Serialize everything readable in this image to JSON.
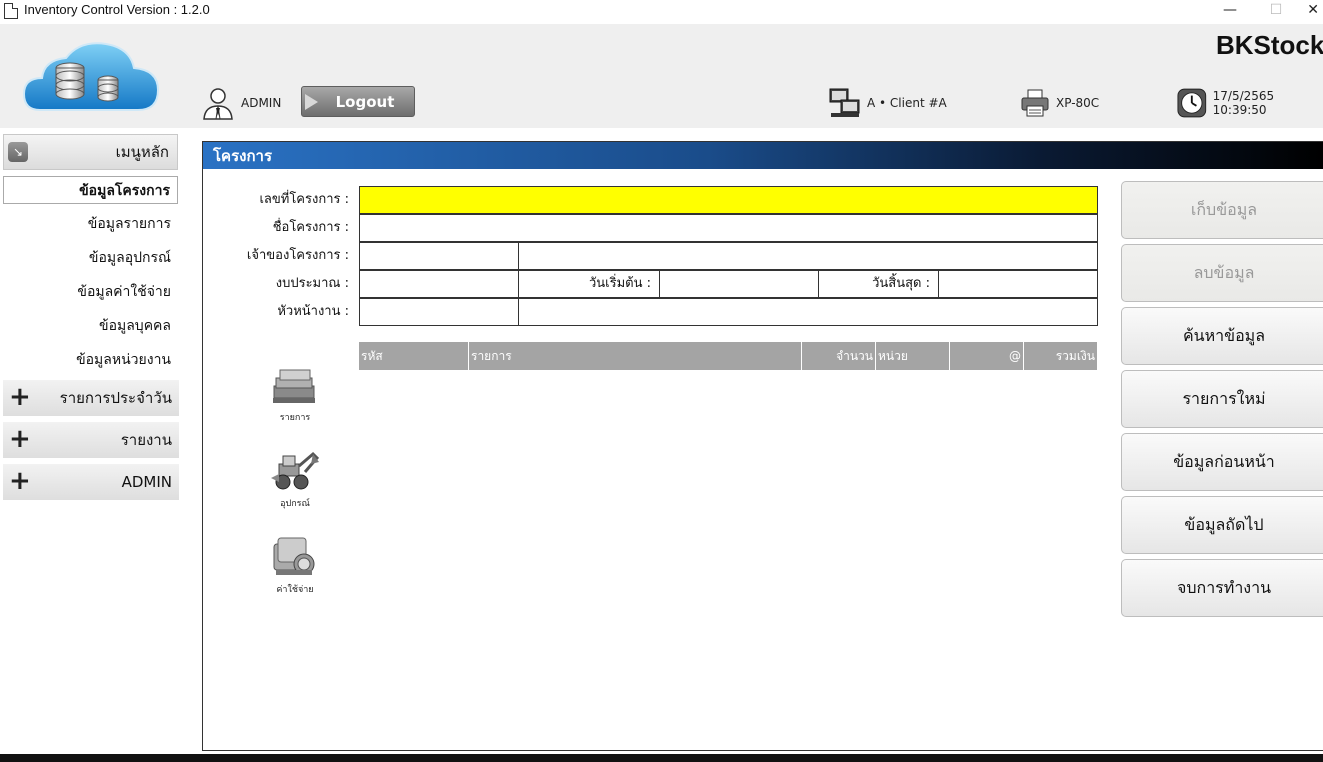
{
  "window": {
    "title": "Inventory Control Version : 1.2.0",
    "minimize": "—",
    "maximize": "☐",
    "close": "✕"
  },
  "header": {
    "brand": "BKStock",
    "user": "ADMIN",
    "logout_label": "Logout",
    "client": "A • Client #A",
    "printer": "XP-80C",
    "datetime": "17/5/2565 10:39:50"
  },
  "sidebar": {
    "main_menu": "เมนูหลัก",
    "sub_items": [
      {
        "label": "ข้อมูลโครงการ",
        "active": true
      },
      {
        "label": "ข้อมูลรายการ",
        "active": false
      },
      {
        "label": "ข้อมูลอุปกรณ์",
        "active": false
      },
      {
        "label": "ข้อมูลค่าใช้จ่าย",
        "active": false
      },
      {
        "label": "ข้อมูลบุคคล",
        "active": false
      },
      {
        "label": "ข้อมูลหน่วยงาน",
        "active": false
      }
    ],
    "groups": [
      {
        "label": "รายการประจำวัน"
      },
      {
        "label": "รายงาน"
      },
      {
        "label": "ADMIN"
      }
    ]
  },
  "panel": {
    "title": "โครงการ",
    "labels": {
      "project_no": "เลขที่โครงการ :",
      "project_name": "ชื่อโครงการ :",
      "owner": "เจ้าของโครงการ :",
      "budget": "งบประมาณ :",
      "start_date": "วันเริ่มต้น :",
      "end_date": "วันสิ้นสุด :",
      "supervisor": "หัวหน้างาน :"
    },
    "values": {
      "project_no": "",
      "project_name": "",
      "owner_code": "",
      "owner_name": "",
      "budget": "",
      "start_date": "",
      "end_date": "",
      "supervisor_code": "",
      "supervisor_name": ""
    },
    "grid_columns": [
      "รหัส",
      "รายการ",
      "จำนวน",
      "หน่วย",
      "@",
      "รวมเงิน"
    ],
    "side_icons": [
      {
        "label": "รายการ",
        "icon": "items-icon"
      },
      {
        "label": "อุปกรณ์",
        "icon": "equipment-icon"
      },
      {
        "label": "ค่าใช้จ่าย",
        "icon": "expense-icon"
      }
    ]
  },
  "actions": [
    {
      "label": "เก็บข้อมูล",
      "enabled": false
    },
    {
      "label": "ลบข้อมูล",
      "enabled": false
    },
    {
      "label": "ค้นหาข้อมูล",
      "enabled": true
    },
    {
      "label": "รายการใหม่",
      "enabled": true
    },
    {
      "label": "ข้อมูลก่อนหน้า",
      "enabled": true
    },
    {
      "label": "ข้อมูลถัดไป",
      "enabled": true
    },
    {
      "label": "จบการทำงาน",
      "enabled": true
    }
  ],
  "colors": {
    "highlight_field": "#ffff00",
    "title_bar_start": "#2a72c4",
    "grid_header": "#a4a4a4"
  }
}
